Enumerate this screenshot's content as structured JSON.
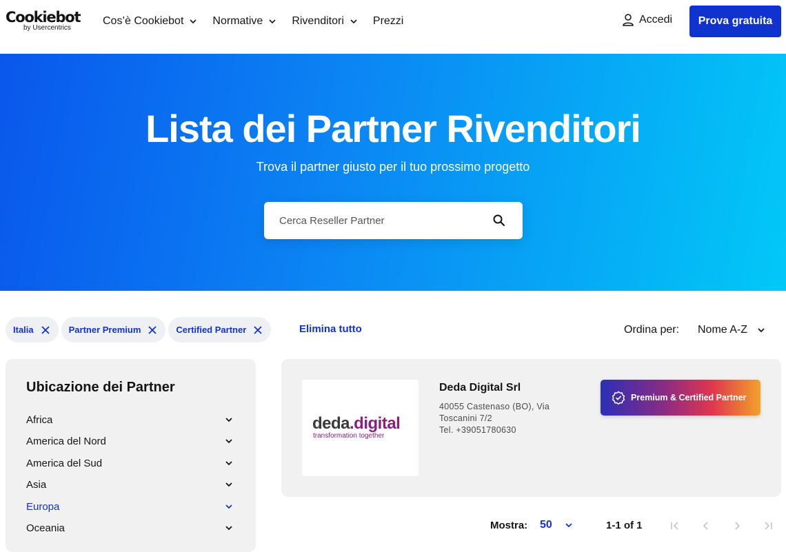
{
  "nav": {
    "logo_main": "Cookiebot",
    "logo_sub": "by Usercentrics",
    "links": [
      {
        "label": "Cos’è Cookiebot",
        "has_dropdown": true
      },
      {
        "label": "Normative",
        "has_dropdown": true
      },
      {
        "label": "Rivenditori",
        "has_dropdown": true
      },
      {
        "label": "Prezzi",
        "has_dropdown": false
      }
    ],
    "login_label": "Accedi",
    "cta_label": "Prova gratuita"
  },
  "hero": {
    "title": "Lista dei Partner Rivenditori",
    "subtitle": "Trova il partner giusto per il tuo prossimo progetto",
    "search_placeholder": "Cerca Reseller Partner",
    "search_value": ""
  },
  "filters": {
    "active": [
      "Italia",
      "Partner Premium",
      "Certified Partner"
    ],
    "clear_all_label": "Elimina tutto",
    "sort_label": "Ordina per:",
    "sort_value": "Nome A-Z"
  },
  "sidebar": {
    "title": "Ubicazione dei Partner",
    "regions": [
      {
        "label": "Africa",
        "active": false
      },
      {
        "label": "America del Nord",
        "active": false
      },
      {
        "label": "America del Sud",
        "active": false
      },
      {
        "label": "Asia",
        "active": false
      },
      {
        "label": "Europa",
        "active": true
      },
      {
        "label": "Oceania",
        "active": false
      }
    ]
  },
  "results": [
    {
      "logo_text_a": "deda",
      "logo_text_b": ".digital",
      "logo_tagline": "transformation together",
      "name": "Deda Digital Srl",
      "address": "40055 Castenaso (BO), Via Toscanini 7/2",
      "phone": "Tel. +39051780630",
      "badge": "Premium & Certified Partner"
    }
  ],
  "pagination": {
    "show_label": "Mostra:",
    "per_page": "50",
    "range": "1-1 of 1"
  },
  "colors": {
    "brand_blue": "#1032cf",
    "hero_start": "#0a57ec",
    "hero_end": "#02c8f7"
  }
}
